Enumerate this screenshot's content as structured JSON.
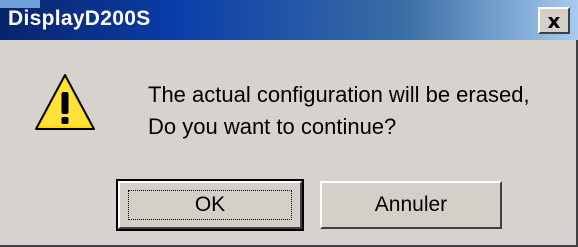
{
  "window": {
    "title": "DisplayD200S",
    "close_glyph": "x",
    "close_icon": "close-icon"
  },
  "dialog": {
    "icon": "warning-icon",
    "message_line1": "The actual configuration will be erased,",
    "message_line2": "Do you want to continue?"
  },
  "buttons": {
    "ok_label": "OK",
    "cancel_label": "Annuler"
  },
  "colors": {
    "titlebar_start": "#0a246a",
    "titlebar_end": "#a6caf0",
    "dialog_bg": "#d6d3ce",
    "warning_yellow": "#ffd800"
  }
}
